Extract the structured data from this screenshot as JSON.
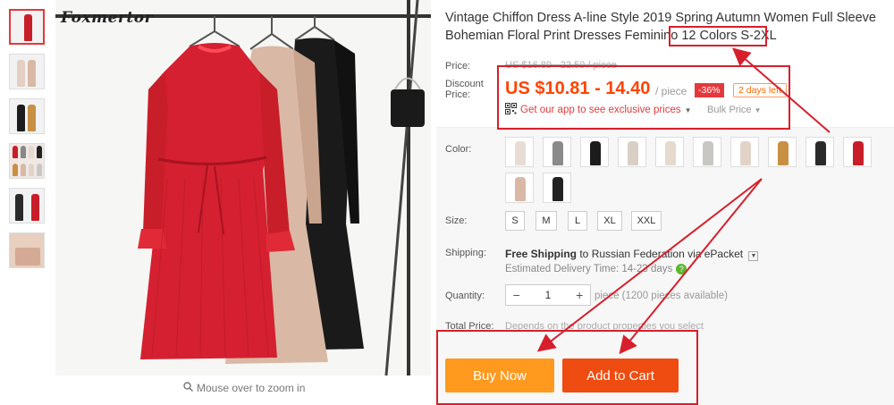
{
  "brand": "Foxmertor",
  "zoom_hint": "Mouse over to zoom in",
  "title": "Vintage Chiffon Dress A-line Style 2019 Spring Autumn Women Full Sleeve Bohemian Floral Print Dresses Feminino 12 Colors S-2XL",
  "price": {
    "label": "Price:",
    "original": "US $16.89 - 22.50 / piece",
    "discount_label": "Discount Price:",
    "discount": "US $10.81 - 14.40",
    "unit": "/ piece",
    "percent_off": "-36%",
    "days_left": "2 days left",
    "app_promo": "Get our app to see exclusive prices",
    "bulk": "Bulk Price"
  },
  "color": {
    "label": "Color:",
    "swatches": [
      "#e8ddd6",
      "#8a8a8a",
      "#1c1c1c",
      "#d9cfc5",
      "#e6d9cd",
      "#c9c7c4",
      "#e1d3c8",
      "#c79045",
      "#2a2a2a",
      "#c81e2a",
      "#d9b9a5",
      "#222222"
    ]
  },
  "size": {
    "label": "Size:",
    "options": [
      "S",
      "M",
      "L",
      "XL",
      "XXL"
    ]
  },
  "shipping": {
    "label": "Shipping:",
    "text_bold": "Free Shipping",
    "text_rest": " to Russian Federation via ePacket",
    "estimated": "Estimated Delivery Time: 14-23 days"
  },
  "quantity": {
    "label": "Quantity:",
    "value": "1",
    "minus": "−",
    "plus": "+",
    "note": "piece (1200 pieces available)"
  },
  "total": {
    "label": "Total Price:",
    "note": "Depends on the product properties you select"
  },
  "buttons": {
    "buy_now": "Buy Now",
    "add_to_cart": "Add to Cart"
  },
  "colors": {
    "accent_red": "#e4393c",
    "price_orange": "#ff4400",
    "buy_now_bg": "#ff9a1f",
    "add_cart_bg": "#ef4c11",
    "annotation": "#d71f2c"
  }
}
